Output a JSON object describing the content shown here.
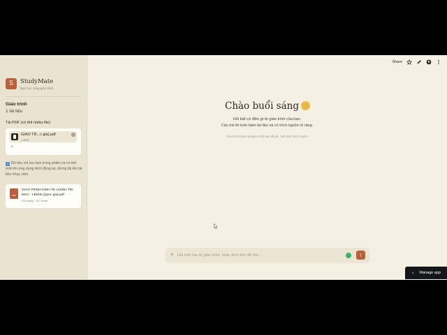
{
  "sidebar": {
    "brand_letter": "S",
    "brand_title": "StudyMate",
    "brand_subtitle": "Bạn học cùng giáo trình",
    "section_title": "Giáo trình",
    "section_count": "1 tài liệu",
    "upload_label": "Tải PDF (có thể nhiều file)",
    "upload_file_name": "GIAO TR...c gia).pdf",
    "upload_file_size": "1.8MB",
    "add_more": "+",
    "notice_icon": "i",
    "notice": "Dữ liệu chỉ lưu tạm trong phiên và có thể mất khi ứng dụng khởi động lại. Đừng tải lên tài liệu nhạy cảm.",
    "doc_icon_label": "PDF",
    "doc_title": "GIAO TRINH KINH TE CHINH TRI MAC - LENIN (Quoc gia).pdf",
    "doc_meta": "250 trang · 517 đoạn"
  },
  "topbar": {
    "share": "Share",
    "icons": [
      "star-icon",
      "edit-icon",
      "github-icon",
      "menu-icon"
    ]
  },
  "main": {
    "greeting": "Chào buổi sáng",
    "subtitle_1": "Hỏi bất cứ điều gì từ giáo trình của bạn.",
    "subtitle_2": "Câu trả lời luôn bám tài liệu và có trích nguồn rõ ràng.",
    "subtitle_3": "Câu trả lời bám sát giáo trình bạn đã tải · luôn kèm trích nguồn"
  },
  "chat": {
    "placeholder": "Hỏi một câu từ giáo trình, hoặc đính ảnh để hỏi...",
    "send": "↑"
  },
  "manage_app": "Manage app",
  "colors": {
    "accent": "#b8603b",
    "background": "#f5f0e4",
    "sidebar": "#ebe3d1"
  }
}
